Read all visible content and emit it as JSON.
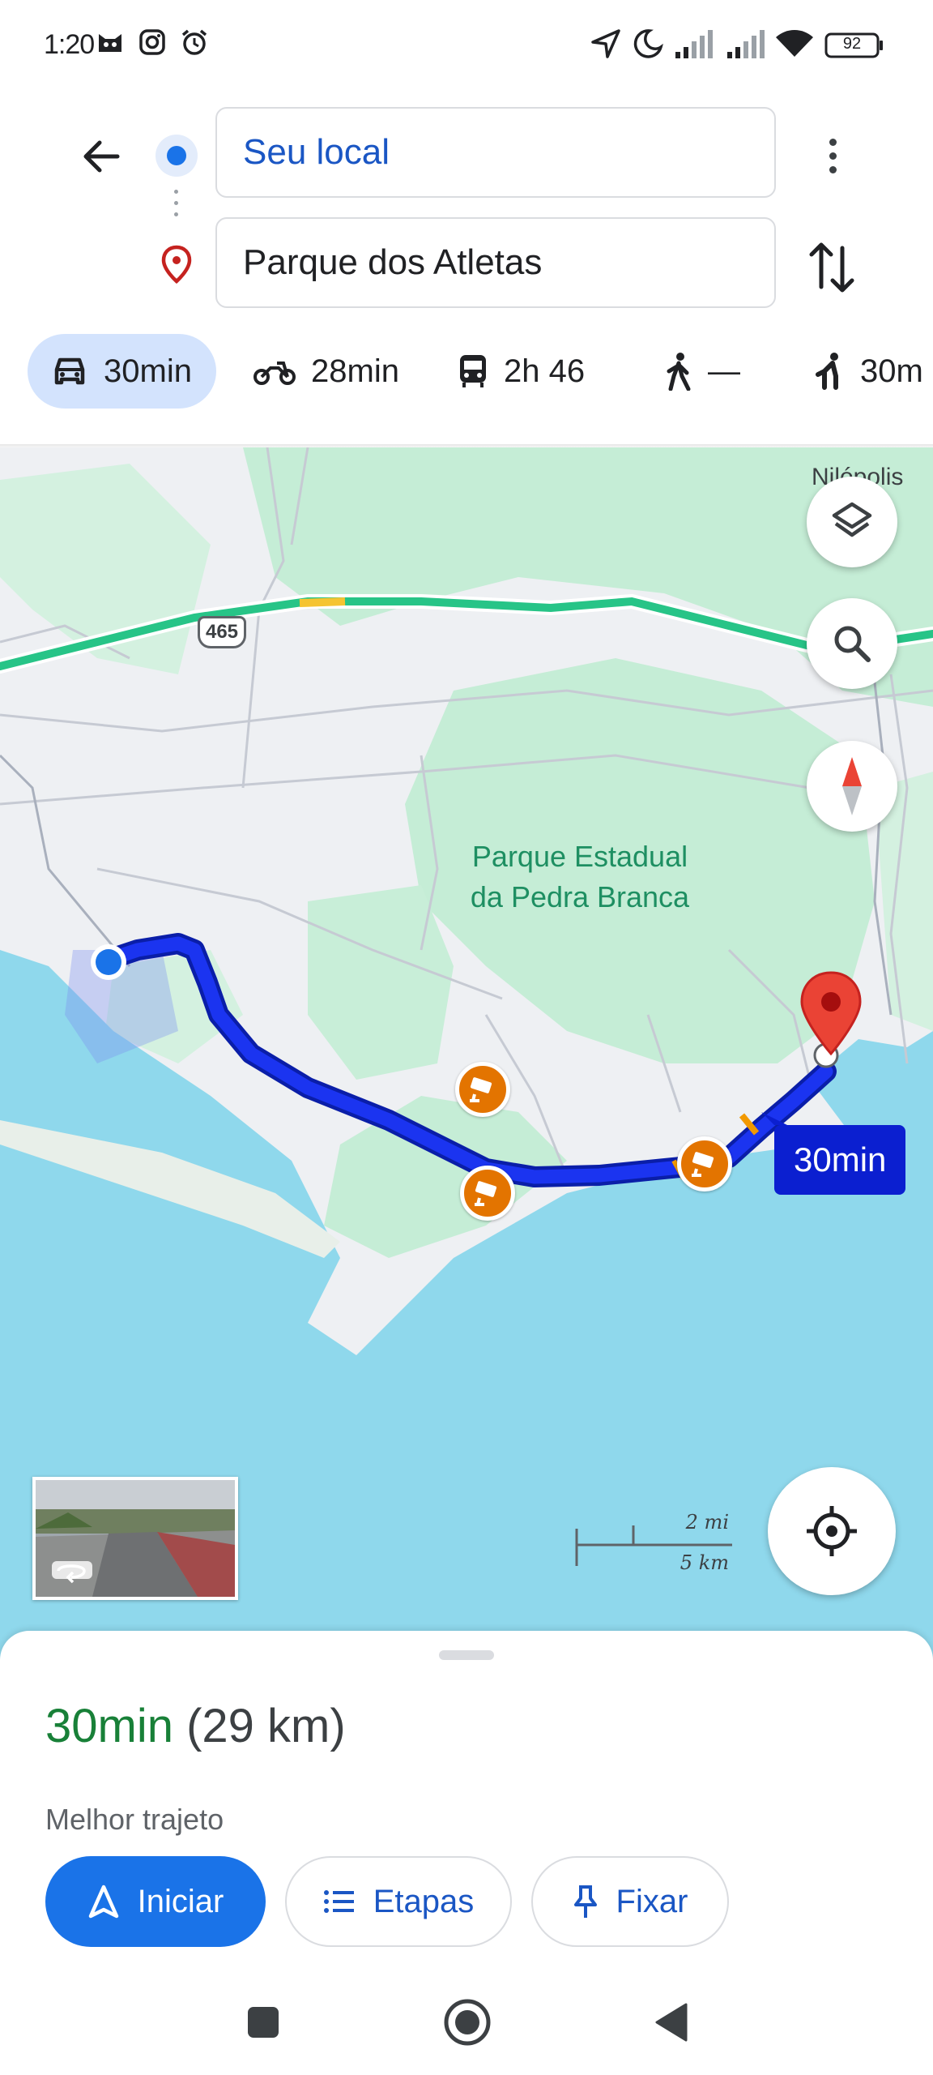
{
  "status_bar": {
    "time": "1:20",
    "battery": "92",
    "icons": [
      "cat-face-icon",
      "instagram-icon",
      "alarm-icon",
      "location-arrow-icon",
      "moon-icon",
      "signal-icon",
      "signal-icon",
      "wifi-icon",
      "battery-icon"
    ]
  },
  "search": {
    "origin": "Seu local",
    "destination": "Parque dos Atletas"
  },
  "modes": [
    {
      "icon": "car-icon",
      "label": "30min",
      "active": true
    },
    {
      "icon": "motorcycle-icon",
      "label": "28min",
      "active": false
    },
    {
      "icon": "transit-icon",
      "label": "2h 46",
      "active": false
    },
    {
      "icon": "walk-icon",
      "label": "—",
      "active": false
    },
    {
      "icon": "ride-icon",
      "label": "30m",
      "active": false
    }
  ],
  "map": {
    "park_label": "Parque Estadual da Pedra Branca",
    "city_label": "Nilópolis",
    "highway_shield": "465",
    "eta_bubble": "30min",
    "scale_mi": "2 mi",
    "scale_km": "5 km",
    "route_color": "#0b1fd0",
    "water_color": "#8fd8ec",
    "park_color": "#c5edd6"
  },
  "sheet": {
    "duration": "30min",
    "distance": "(29 km)",
    "description": "Melhor trajeto",
    "start_label": "Iniciar",
    "steps_label": "Etapas",
    "pin_label": "Fixar"
  }
}
